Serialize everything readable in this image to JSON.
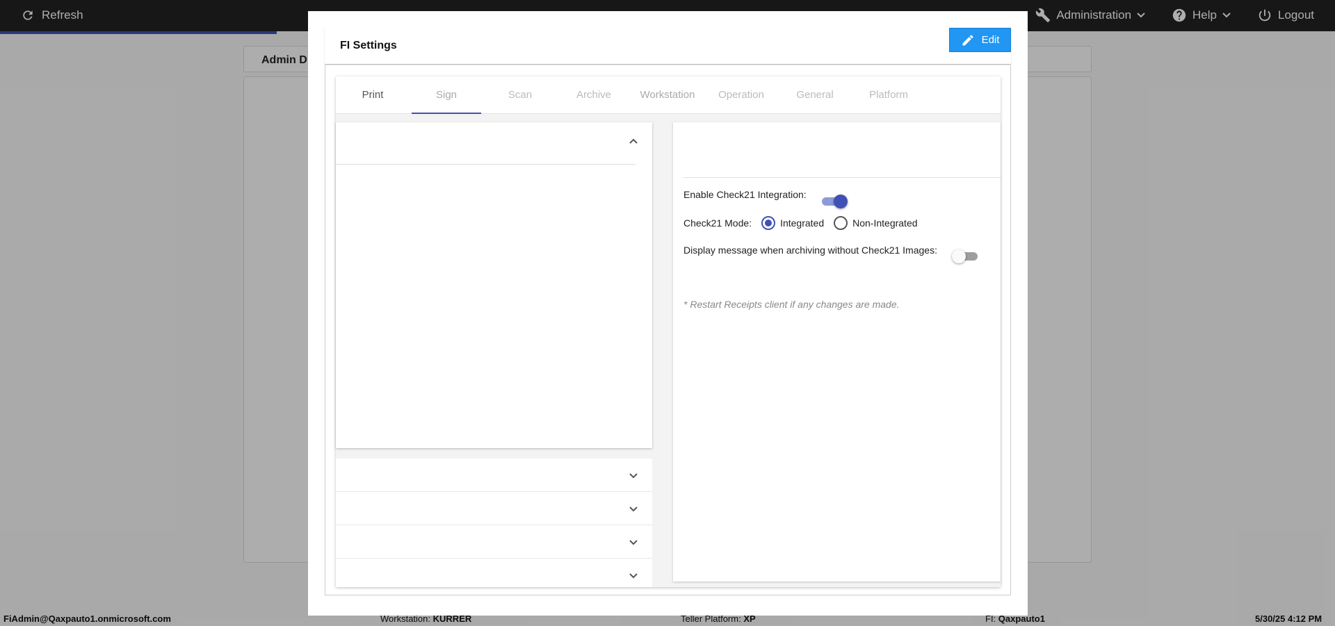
{
  "topbar": {
    "refresh_label": "Refresh",
    "administration_label": "Administration",
    "help_label": "Help",
    "logout_label": "Logout"
  },
  "background": {
    "card_title": "Admin D"
  },
  "statusbar": {
    "user": "FiAdmin@Qaxpauto1.onmicrosoft.com",
    "workstation_label": "Workstation:",
    "workstation_value": "KURRER",
    "platform_label": "Teller Platform:",
    "platform_value": "XP",
    "fi_label": "FI:",
    "fi_value": "Qaxpauto1",
    "datetime": "5/30/25 4:12 PM"
  },
  "modal": {
    "title": "FI Settings",
    "edit_label": "Edit",
    "tabs": [
      {
        "label": "Print"
      },
      {
        "label": "Sign"
      },
      {
        "label": "Scan"
      },
      {
        "label": "Archive"
      },
      {
        "label": "Workstation"
      },
      {
        "label": "Operation"
      },
      {
        "label": "General"
      },
      {
        "label": "Platform"
      }
    ],
    "active_tab": "Sign",
    "settings": {
      "enable_check21_label": "Enable Check21 Integration:",
      "enable_check21_value": true,
      "check21_mode_label": "Check21 Mode:",
      "mode_options": [
        "Integrated",
        "Non-Integrated"
      ],
      "mode_selected": "Integrated",
      "display_message_label": "Display message when archiving without Check21 Images:",
      "display_message_value": false,
      "restart_note": "* Restart Receipts client if any changes are made."
    }
  },
  "colors": {
    "accent": "#3f51b5",
    "edit_button": "#2196f3",
    "topbar": "#222222"
  }
}
